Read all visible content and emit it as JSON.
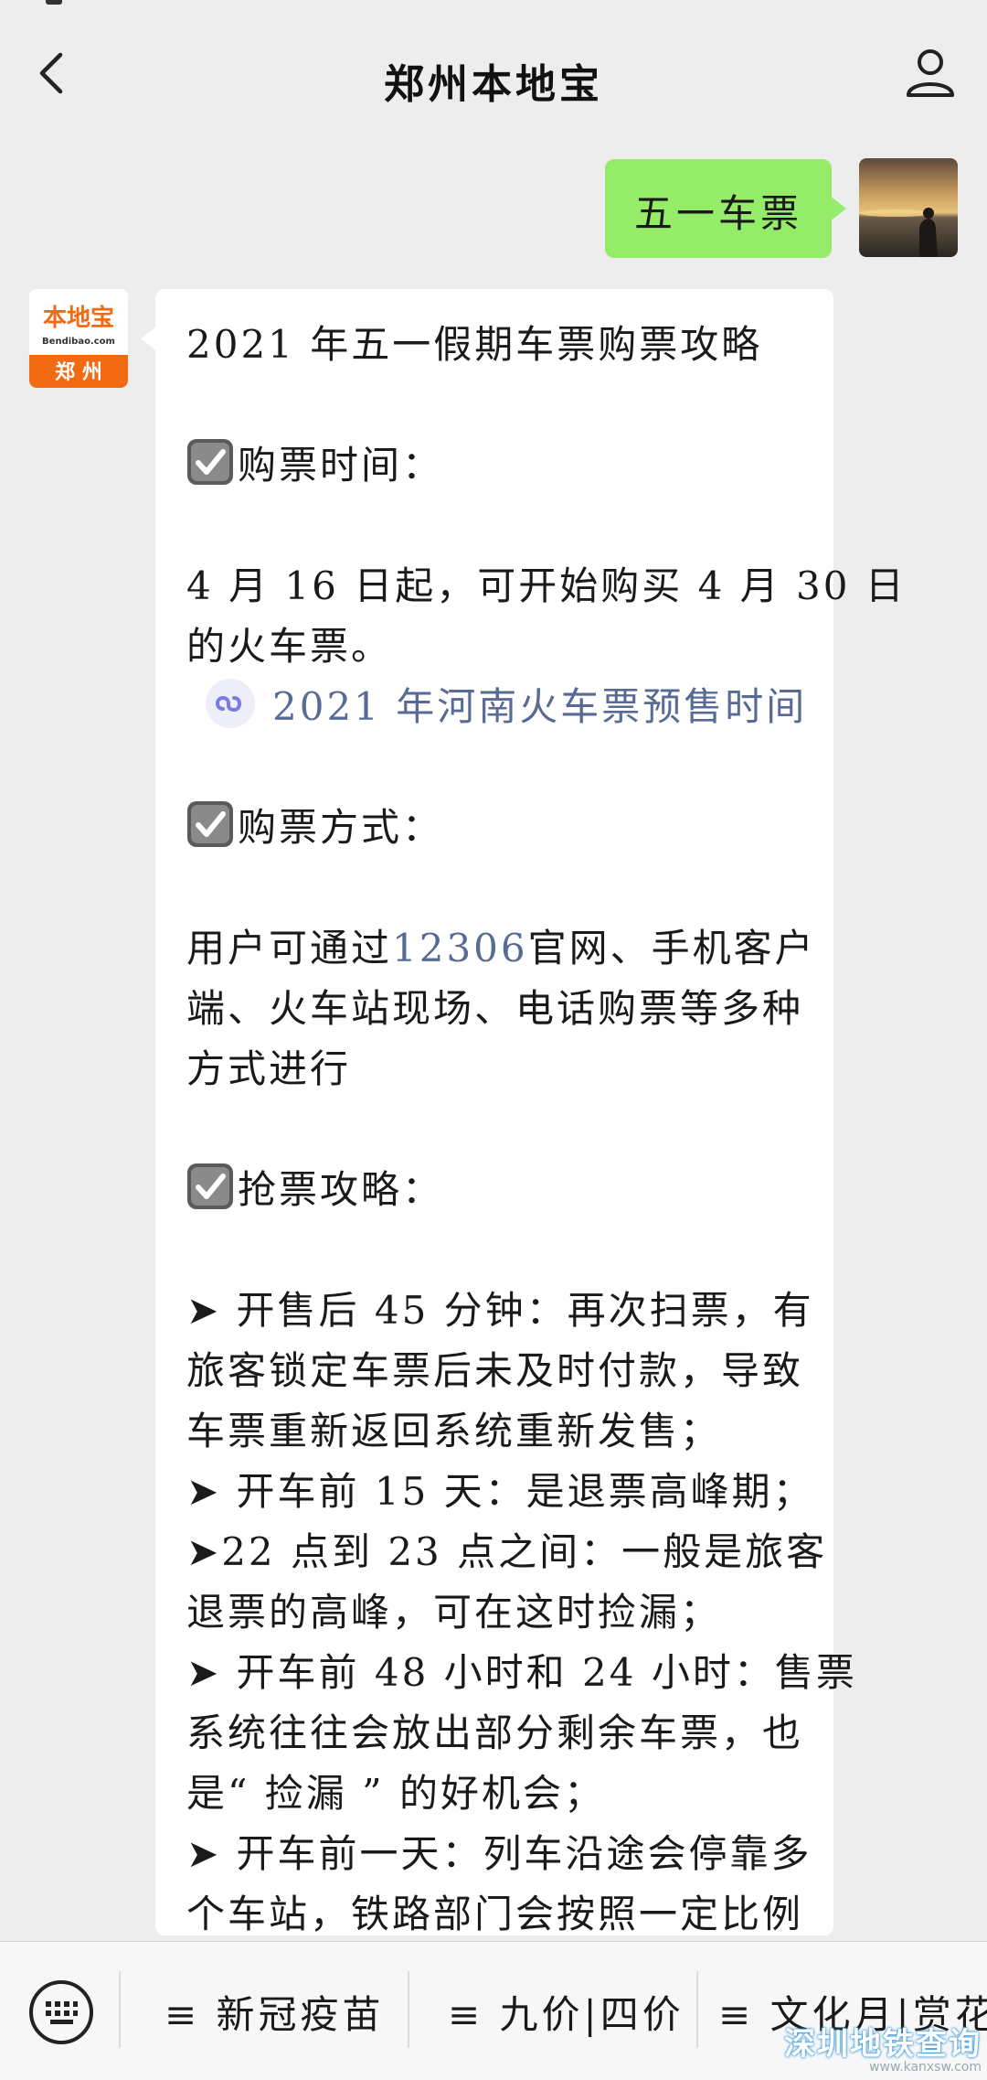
{
  "header": {
    "title": "郑州本地宝"
  },
  "outgoing": {
    "text": "五一车票"
  },
  "bot_avatar": {
    "brand_text": "本地宝",
    "domain_text": "Bendibao.com",
    "city_text": "郑 州"
  },
  "message": {
    "title": "2021 年五一假期车票购票攻略",
    "section1_heading": "购票时间：",
    "section1_line1": "4 月 16 日起，可开始购买 4 月 30 日",
    "section1_line2": "的火车票。",
    "mini_link": "2021 年河南火车票预售时间",
    "section2_heading": "购票方式：",
    "section2_line1_prefix": "用户可通过",
    "section2_line1_link": "12306",
    "section2_line1_suffix": "官网、手机客户",
    "section2_line2": "端、火车站现场、电话购票等多种",
    "section2_line3": "方式进行",
    "section3_heading": "抢票攻略：",
    "tips": [
      "➤ 开售后 45 分钟：再次扫票，有",
      "旅客锁定车票后未及时付款，导致",
      "车票重新返回系统重新发售；",
      "➤ 开车前 15 天：是退票高峰期；",
      "➤22 点到 23 点之间：一般是旅客",
      "退票的高峰，可在这时捡漏；",
      "➤ 开车前 48 小时和 24 小时：售票",
      "系统往往会放出部分剩余车票，也",
      "是“ 捡漏 ” 的好机会；",
      "➤ 开车前一天：列车沿途会停靠多",
      "个车站，铁路部门会按照一定比例"
    ]
  },
  "bottom_menu": {
    "items": [
      "≡ 新冠疫苗",
      "≡ 九价|四价",
      "≡ 文化月|赏花"
    ]
  },
  "watermark": {
    "title": "深圳地铁查询",
    "domain": "www.kanxsw.com"
  },
  "colors": {
    "page_bg": "#ededed",
    "outgoing_bubble": "#95ec69",
    "link": "#576b95",
    "brand_orange": "#f26a12"
  }
}
